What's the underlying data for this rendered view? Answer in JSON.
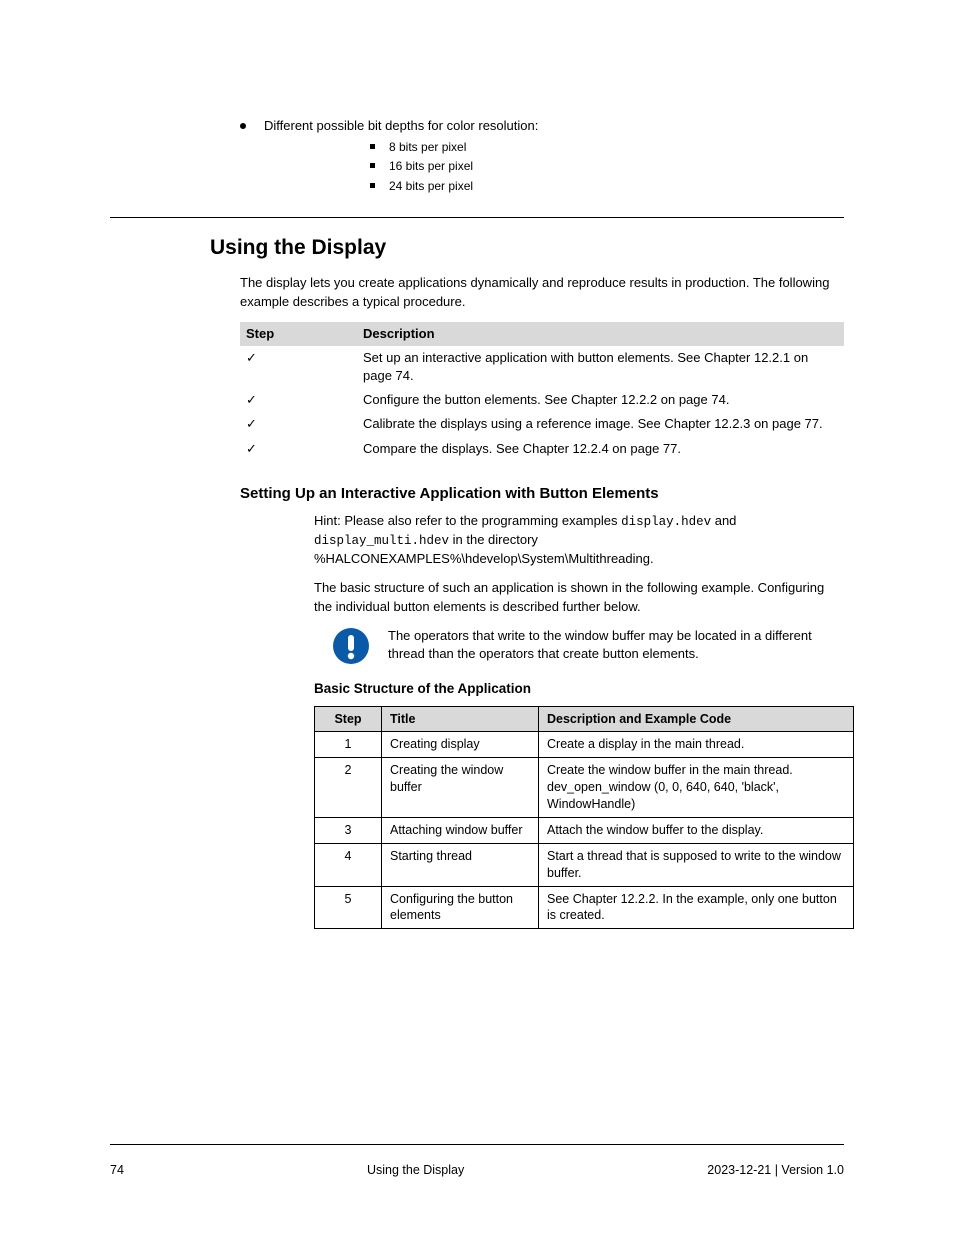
{
  "top": {
    "bullet": "Different possible bit depths for color resolution:",
    "items": [
      "8 bits per pixel",
      "16 bits per pixel",
      "24 bits per pixel"
    ]
  },
  "section_heading": "Using the Display",
  "intro_para": "The display lets you create applications dynamically and reproduce results in production. The following example describes a typical procedure.",
  "step_table": {
    "headers": [
      "Step",
      "Description"
    ],
    "rows": [
      {
        "step": "✓",
        "desc": "Set up an interactive application with button elements. See Chapter 12.2.1 on page 74."
      },
      {
        "step": "✓",
        "desc": "Configure the button elements. See Chapter 12.2.2 on page 74."
      },
      {
        "step": "✓",
        "desc": "Calibrate the displays using a reference image. See Chapter 12.2.3 on page 77."
      },
      {
        "step": "✓",
        "desc": "Compare the displays. See Chapter 12.2.4 on page 77."
      }
    ]
  },
  "h3": "Setting Up an Interactive Application with Button Elements",
  "app_para1_prefix": "Hint: Please also refer to the programming examples ",
  "app_code1": "display.hdev",
  "app_mid": " and ",
  "app_code2": "display_multi.hdev",
  "app_para1_suffix": " in the directory %HALCONEXAMPLES%\\hdevelop\\System\\Multithreading.",
  "app_para2": "The basic structure of such an application is shown in the following example. Configuring the individual button elements is described further below.",
  "notice_text": "The operators that write to the window buffer may be located in a different thread than the operators that create button elements.",
  "h4": "Basic Structure of the Application",
  "struct_table": {
    "headers": [
      "Step",
      "Title",
      "Description and Example Code"
    ],
    "rows": [
      {
        "n": "1",
        "title": "Creating display",
        "desc": "Create a display in the main thread."
      },
      {
        "n": "2",
        "title": "Creating the window buffer",
        "desc": "Create the window buffer in the main thread. dev_open_window (0, 0, 640, 640, 'black', WindowHandle)"
      },
      {
        "n": "3",
        "title": "Attaching window buffer",
        "desc": "Attach the window buffer to the display."
      },
      {
        "n": "4",
        "title": "Starting thread",
        "desc": "Start a thread that is supposed to write to the window buffer."
      },
      {
        "n": "5",
        "title": "Configuring the button elements",
        "desc": "See Chapter 12.2.2. In the example, only one button is created."
      }
    ]
  },
  "footer": {
    "left": "74",
    "center": "Using the Display",
    "right": "2023-12-21 | Version 1.0"
  }
}
